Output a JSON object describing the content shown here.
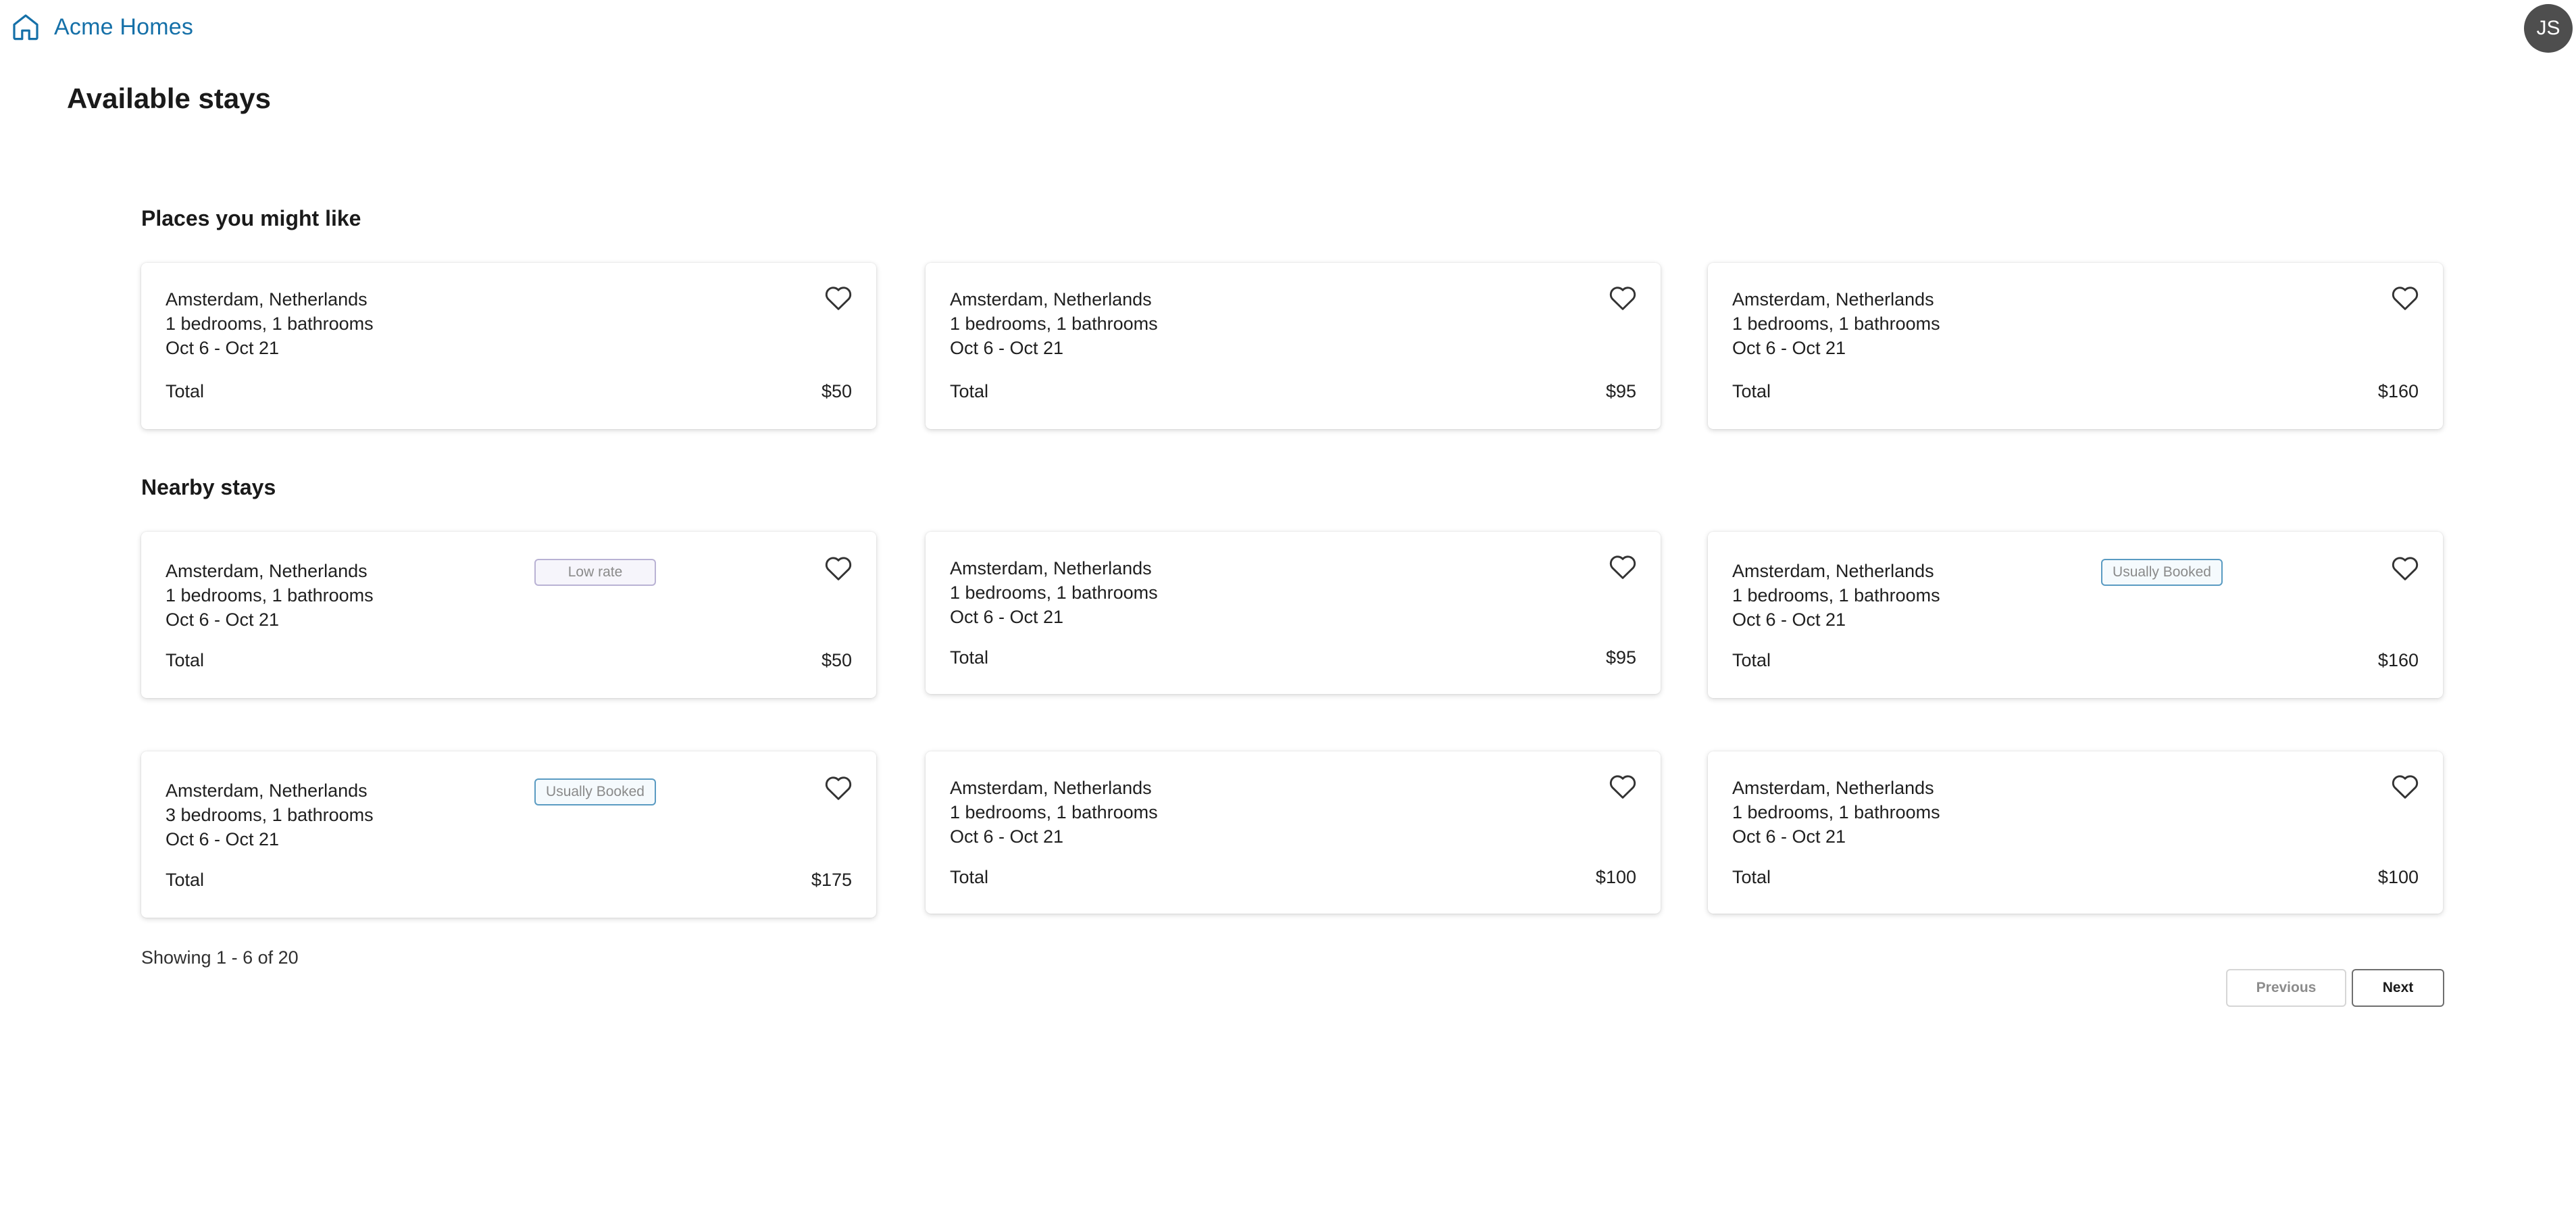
{
  "header": {
    "brand_name": "Acme Homes",
    "brand_icon": "home-icon",
    "avatar_initials": "JS"
  },
  "page_title": "Available stays",
  "colors": {
    "brand": "#1570a8",
    "avatar_bg": "#4e4e4e"
  },
  "sections": {
    "places": {
      "title": "Places you might like",
      "cards": [
        {
          "location": "Amsterdam, Netherlands",
          "rooms": "1 bedrooms, 1 bathrooms",
          "dates": "Oct 6 - Oct 21",
          "total_label": "Total",
          "price": "$50",
          "badge": ""
        },
        {
          "location": "Amsterdam, Netherlands",
          "rooms": "1 bedrooms, 1 bathrooms",
          "dates": "Oct 6 - Oct 21",
          "total_label": "Total",
          "price": "$95",
          "badge": ""
        },
        {
          "location": "Amsterdam, Netherlands",
          "rooms": "1 bedrooms, 1 bathrooms",
          "dates": "Oct 6 - Oct 21",
          "total_label": "Total",
          "price": "$160",
          "badge": ""
        }
      ]
    },
    "nearby": {
      "title": "Nearby stays",
      "cards": [
        {
          "location": "Amsterdam, Netherlands",
          "rooms": "1 bedrooms, 1 bathrooms",
          "dates": "Oct 6 - Oct 21",
          "total_label": "Total",
          "price": "$50",
          "badge": "Low rate"
        },
        {
          "location": "Amsterdam, Netherlands",
          "rooms": "1 bedrooms, 1 bathrooms",
          "dates": "Oct 6 - Oct 21",
          "total_label": "Total",
          "price": "$95",
          "badge": ""
        },
        {
          "location": "Amsterdam, Netherlands",
          "rooms": "1 bedrooms, 1 bathrooms",
          "dates": "Oct 6 - Oct 21",
          "total_label": "Total",
          "price": "$160",
          "badge": "Usually Booked"
        },
        {
          "location": "Amsterdam, Netherlands",
          "rooms": "3 bedrooms, 1 bathrooms",
          "dates": "Oct 6 - Oct 21",
          "total_label": "Total",
          "price": "$175",
          "badge": "Usually Booked"
        },
        {
          "location": "Amsterdam, Netherlands",
          "rooms": "1 bedrooms, 1 bathrooms",
          "dates": "Oct 6 - Oct 21",
          "total_label": "Total",
          "price": "$100",
          "badge": ""
        },
        {
          "location": "Amsterdam, Netherlands",
          "rooms": "1 bedrooms, 1 bathrooms",
          "dates": "Oct 6 - Oct 21",
          "total_label": "Total",
          "price": "$100",
          "badge": ""
        }
      ]
    }
  },
  "pagination": {
    "showing": "Showing 1 - 6 of 20",
    "previous_label": "Previous",
    "next_label": "Next"
  }
}
